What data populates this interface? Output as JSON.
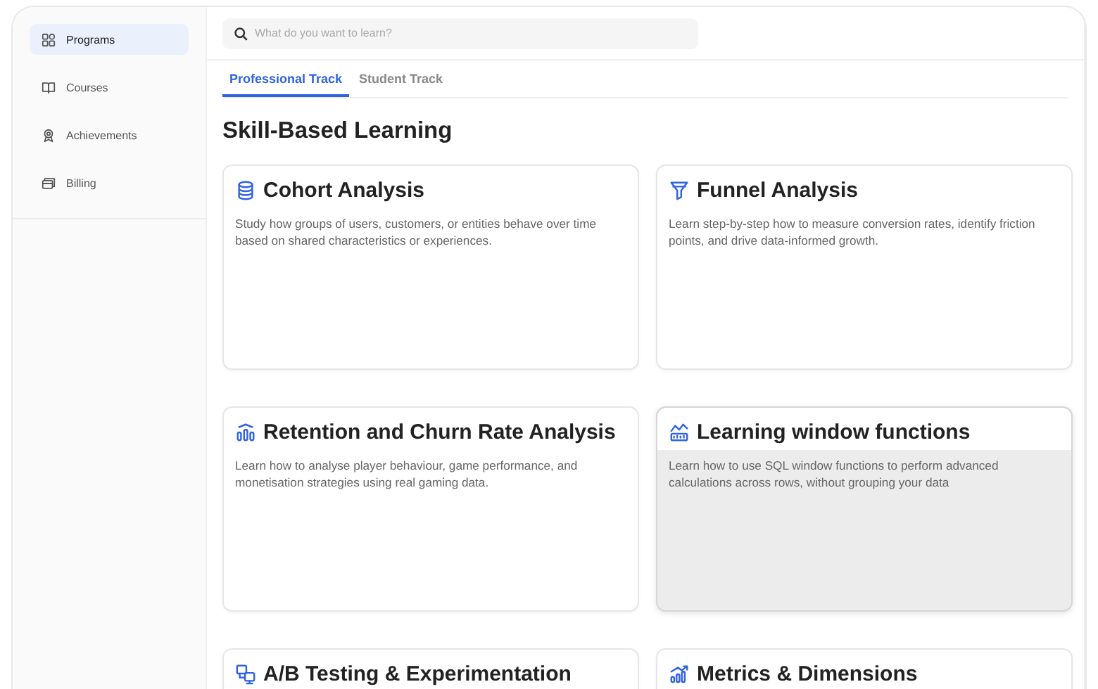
{
  "sidebar": {
    "items": [
      {
        "label": "Programs",
        "selected": true
      },
      {
        "label": "Courses",
        "selected": false
      },
      {
        "label": "Achievements",
        "selected": false
      },
      {
        "label": "Billing",
        "selected": false
      }
    ]
  },
  "search": {
    "placeholder": "What do you want to learn?"
  },
  "tabs": [
    {
      "label": "Professional Track",
      "selected": true
    },
    {
      "label": "Student Track",
      "selected": false
    }
  ],
  "heading": "Skill-Based Learning",
  "cards": [
    {
      "title": "Cohort Analysis",
      "description": "Study how groups of users, customers, or entities behave over time based on shared characteristics or experiences.",
      "highlighted": false
    },
    {
      "title": "Funnel Analysis",
      "description": "Learn step-by-step how to measure conversion rates, identify friction points, and drive data-informed growth.",
      "highlighted": false
    },
    {
      "title": "Retention and Churn Rate Analysis",
      "description": "Learn how to analyse player behaviour, game performance, and monetisation strategies using real gaming data.",
      "highlighted": false
    },
    {
      "title": "Learning window functions",
      "description": "Learn how to use SQL window functions to perform advanced calculations across rows, without grouping your data",
      "highlighted": true
    },
    {
      "title": "A/B Testing & Experimentation",
      "highlighted": false
    },
    {
      "title": "Metrics & Dimensions",
      "highlighted": false
    }
  ]
}
